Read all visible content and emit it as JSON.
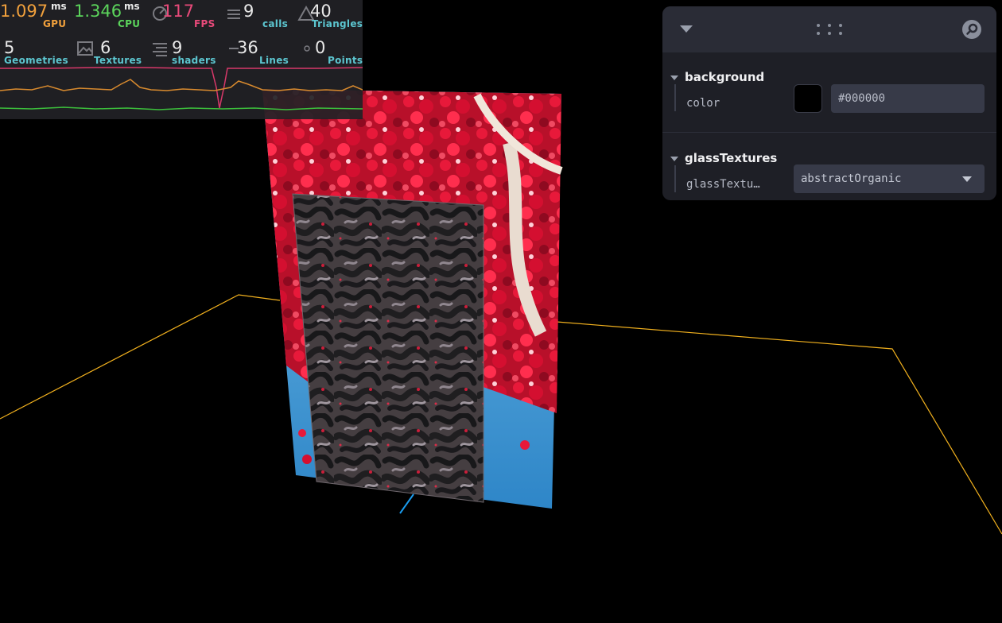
{
  "stats": {
    "gpu": {
      "value": "1.097",
      "unit": "ms",
      "label": "GPU",
      "color": "#f0a03c"
    },
    "cpu": {
      "value": "1.346",
      "unit": "ms",
      "label": "CPU",
      "color": "#5bd45b"
    },
    "fps": {
      "value": "117",
      "label": "FPS",
      "color": "#e84a7a"
    },
    "calls": {
      "value": "9",
      "label": "calls",
      "color": "#5cc6d0"
    },
    "triangles": {
      "value": "40",
      "label": "Triangles",
      "color": "#5cc6d0"
    },
    "geometries": {
      "value": "5",
      "label": "Geometries",
      "color": "#5cc6d0"
    },
    "textures": {
      "value": "6",
      "label": "Textures",
      "color": "#5cc6d0"
    },
    "shaders": {
      "value": "9",
      "label": "shaders",
      "color": "#5cc6d0"
    },
    "lines": {
      "value": "36",
      "label": "Lines",
      "color": "#5cc6d0"
    },
    "points": {
      "value": "0",
      "label": "Points",
      "color": "#5cc6d0"
    }
  },
  "panel": {
    "folders": [
      {
        "title": "background",
        "control_label": "color",
        "color_value": "#000000",
        "swatch_color": "#000000"
      },
      {
        "title": "glassTextures",
        "control_label": "glassTextu…",
        "selected_option": "abstractOrganic"
      }
    ]
  },
  "colors": {
    "grid_line": "#f2b11e",
    "axis_line": "#1a9df0",
    "panel_bg": "#1e1f26"
  }
}
